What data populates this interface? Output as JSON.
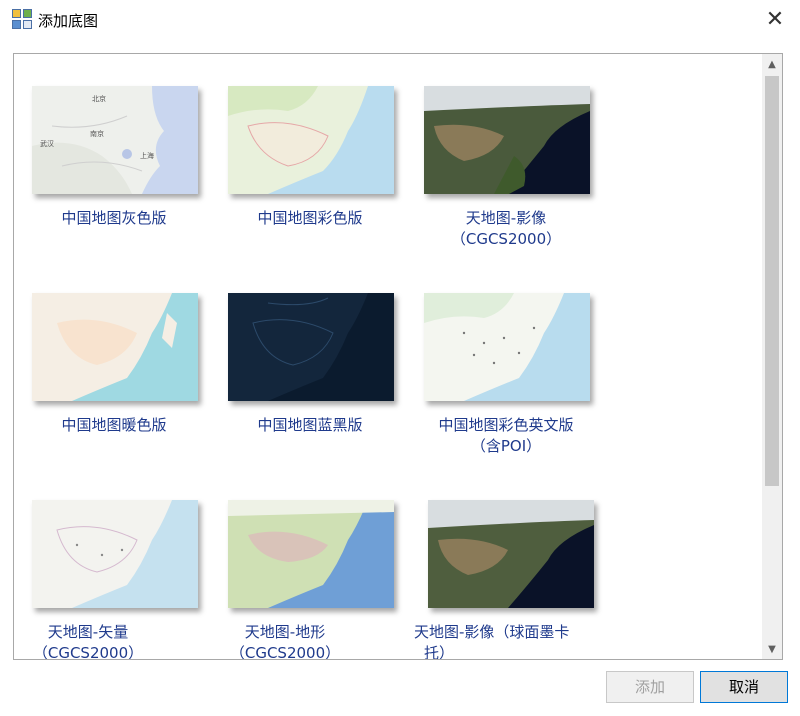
{
  "window": {
    "title": "添加底图",
    "close_glyph": "✕"
  },
  "tiles": [
    {
      "line1": "中国地图灰色版",
      "line2": ""
    },
    {
      "line1": "中国地图彩色版",
      "line2": ""
    },
    {
      "line1": "天地图-影像",
      "line2": "（CGCS2000）"
    },
    {
      "line1": "中国地图暖色版",
      "line2": ""
    },
    {
      "line1": "中国地图蓝黑版",
      "line2": ""
    },
    {
      "line1": "中国地图彩色英文版",
      "line2": "（含POI）"
    },
    {
      "line1": "天地图-矢量",
      "line2": "（CGCS2000）"
    },
    {
      "line1": "天地图-地形",
      "line2": "（CGCS2000）"
    },
    {
      "line1": "天地图-影像（球面墨卡",
      "line2": "托）"
    }
  ],
  "buttons": {
    "add": "添加",
    "cancel": "取消"
  },
  "scrollbar": {
    "up": "▲",
    "down": "▼"
  }
}
